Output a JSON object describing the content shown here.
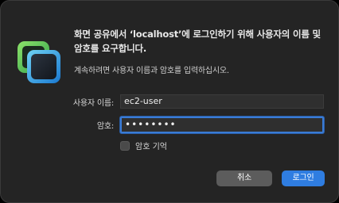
{
  "dialog": {
    "message": "화면 공유에서 ‘localhost’에 로그인하기 위해 사용자의 이름 및 암호를 요구합니다.",
    "submessage": "계속하려면 사용자 이름과 암호를 입력하십시오.",
    "username_label": "사용자 이름:",
    "username_value": "ec2-user",
    "password_label": "암호:",
    "password_value": "••••••••",
    "remember_label": "암호 기억",
    "remember_checked": false,
    "cancel_label": "취소",
    "login_label": "로그인"
  },
  "colors": {
    "background": "#242424",
    "accent": "#2f7de1",
    "cancel_button": "#5c5c5c",
    "focus_ring": "#3a7bd5"
  },
  "icons": {
    "app_icon": "screen-sharing-icon"
  }
}
